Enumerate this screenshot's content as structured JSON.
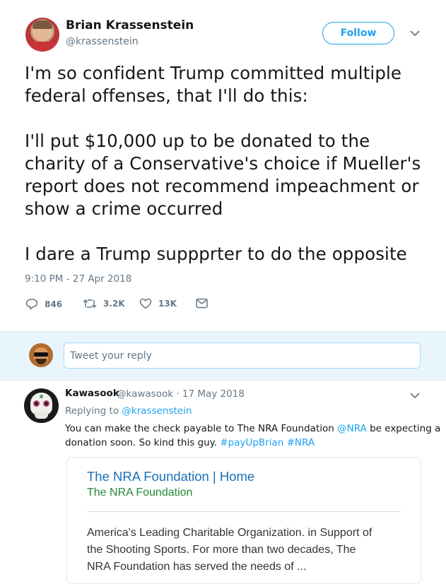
{
  "tweet": {
    "display_name": "Brian Krassenstein",
    "handle": "@krassenstein",
    "follow_label": "Follow",
    "lines": [
      "I'm so confident Trump committed multiple",
      "federal offenses, that I'll do this:",
      "I'll put $10,000 up to be donated to the",
      "charity of a Conservative's choice if Mueller's",
      "report does not recommend impeachment or",
      "show a crime occurred",
      "I dare a Trump suppprter to do the opposite"
    ],
    "timestamp": "9:10 PM - 27 Apr 2018",
    "actions": {
      "replies": "846",
      "retweets": "3.2K",
      "likes": "13K"
    }
  },
  "reply_box": {
    "placeholder": "Tweet your reply"
  },
  "reply": {
    "name": "Kawasook",
    "meta": "@kawasook · 17 May 2018",
    "replying_prefix": "Replying to",
    "replying_handle": "@krassenstein",
    "text_line1_a": "You can make the check payable to The NRA Foundation",
    "text_line1_b": "@NRA",
    "text_line1_c": "be expecting a",
    "text_line2_a": "donation soon. So kind this guy.",
    "text_line2_b": "#payUpBrian",
    "text_line2_c": "#NRA",
    "card": {
      "title": "The NRA Foundation | Home",
      "site": "The NRA Foundation",
      "desc_lines": [
        "America's Leading Charitable Organization. in Support of",
        "the Shooting Sports. For more than two decades, The",
        "NRA Foundation has served the needs of ..."
      ]
    }
  },
  "colors": {
    "accent": "#1da1f2",
    "muted": "#657786",
    "reply_bar_bg": "#e8f5fd",
    "card_title": "#1a6fb7",
    "card_site": "#278a36"
  },
  "icons": [
    "reply-icon",
    "retweet-icon",
    "like-icon",
    "message-icon",
    "chevron-down-icon"
  ]
}
